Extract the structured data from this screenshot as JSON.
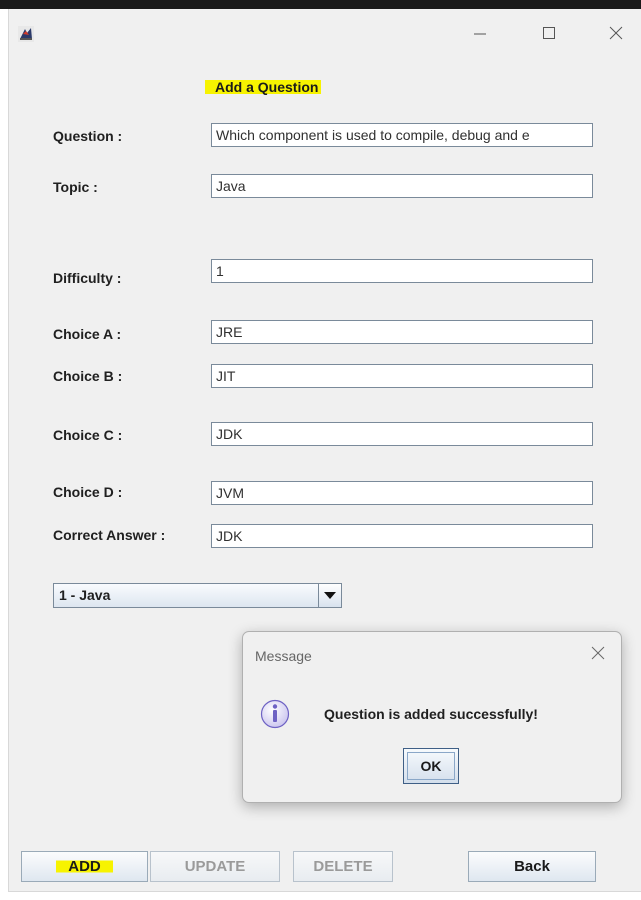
{
  "window": {
    "title": "",
    "heading": "Add a Question"
  },
  "form": {
    "question": {
      "label": "Question :",
      "value": "Which component is used to compile, debug and e"
    },
    "topic": {
      "label": "Topic :",
      "value": "Java"
    },
    "difficulty": {
      "label": "Difficulty :",
      "value": "1"
    },
    "choice_a": {
      "label": "Choice A :",
      "value": "JRE"
    },
    "choice_b": {
      "label": "Choice B :",
      "value": "JIT"
    },
    "choice_c": {
      "label": "Choice C :",
      "value": "JDK"
    },
    "choice_d": {
      "label": "Choice D :",
      "value": "JVM"
    },
    "correct_answer": {
      "label": "Correct Answer :",
      "value": "JDK"
    },
    "topic_select": {
      "value": "1 - Java"
    }
  },
  "dialog": {
    "title": "Message",
    "message": "Question is added successfully!",
    "ok_label": "OK",
    "icon": "info-icon"
  },
  "buttons": {
    "add": "ADD",
    "update": "UPDATE",
    "delete": "DELETE",
    "back": "Back"
  },
  "colors": {
    "highlight": "#f7f300",
    "window_bg": "#f0f0f0",
    "info_icon": "#6e62c4"
  }
}
